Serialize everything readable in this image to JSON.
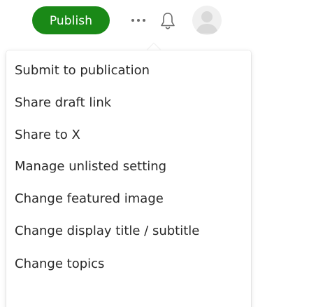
{
  "toolbar": {
    "publish_label": "Publish",
    "more_icon": "more-horizontal-icon",
    "bell_icon": "bell-icon",
    "avatar_icon": "user-avatar"
  },
  "menu": {
    "items": [
      {
        "label": "Submit to publication"
      },
      {
        "label": "Share draft link"
      },
      {
        "label": "Share to X"
      },
      {
        "label": "Manage unlisted setting"
      },
      {
        "label": "Change featured image"
      },
      {
        "label": "Change display title / subtitle"
      },
      {
        "label": "Change topics"
      }
    ]
  },
  "colors": {
    "publish_green": "#1a8917",
    "text": "#292929",
    "icon": "#6b6b6b",
    "avatar_bg": "#f0f0f0",
    "avatar_fg": "#d9d9d9"
  }
}
